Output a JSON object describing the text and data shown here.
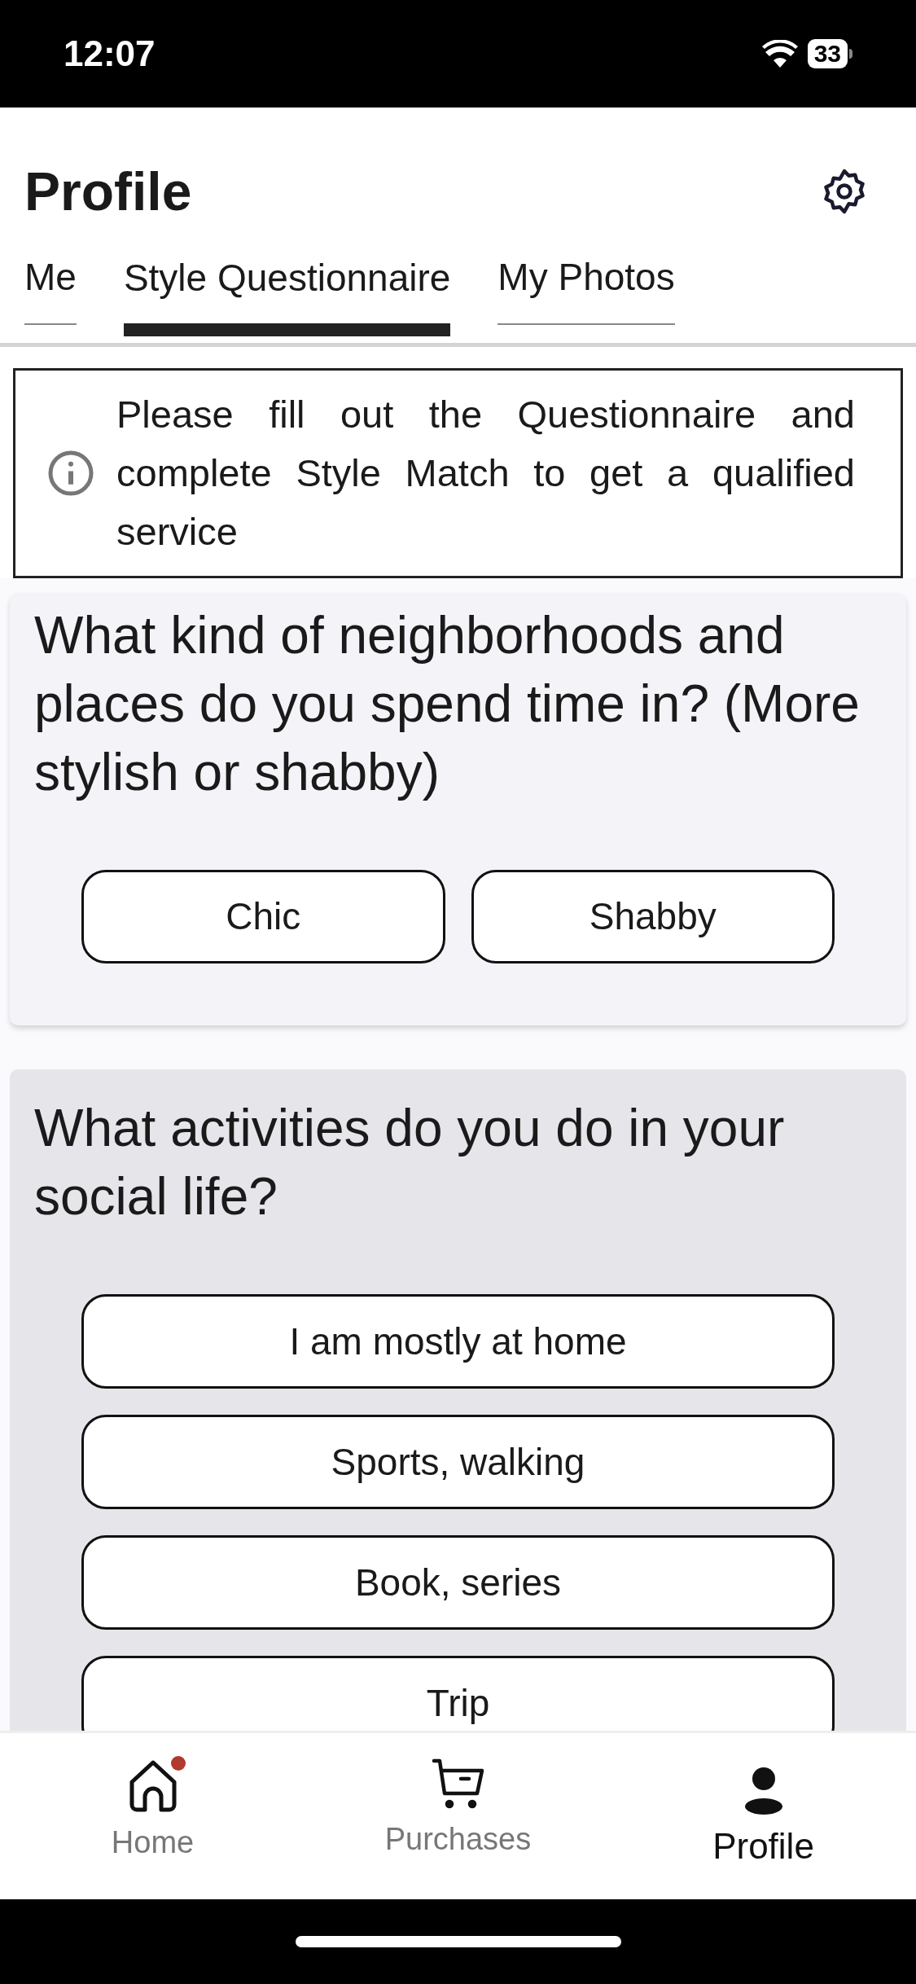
{
  "status_bar": {
    "time": "12:07",
    "battery": "33"
  },
  "header": {
    "title": "Profile"
  },
  "tabs": [
    {
      "label": "Me",
      "selected": false
    },
    {
      "label": "Style Questionnaire",
      "selected": true
    },
    {
      "label": "My Photos",
      "selected": false
    }
  ],
  "notice": {
    "text": "Please fill out the Questionnaire and complete Style Match to get a qualified service"
  },
  "questions": [
    {
      "text": "What kind of neighborhoods and places do you spend time in? (More stylish or shabby)",
      "kind": "grid",
      "options": [
        "Chic",
        "Shabby"
      ]
    },
    {
      "text": "What activities do you do in your social life?",
      "kind": "list",
      "options": [
        "I am mostly at home",
        "Sports, walking",
        "Book, series",
        "Trip"
      ]
    }
  ],
  "nav": [
    {
      "kind": "home",
      "label": "Home",
      "selected": false,
      "has_notification": true
    },
    {
      "kind": "cart",
      "label": "Purchases",
      "selected": false,
      "has_notification": false
    },
    {
      "kind": "person",
      "label": "Profile",
      "selected": true,
      "has_notification": false
    }
  ]
}
